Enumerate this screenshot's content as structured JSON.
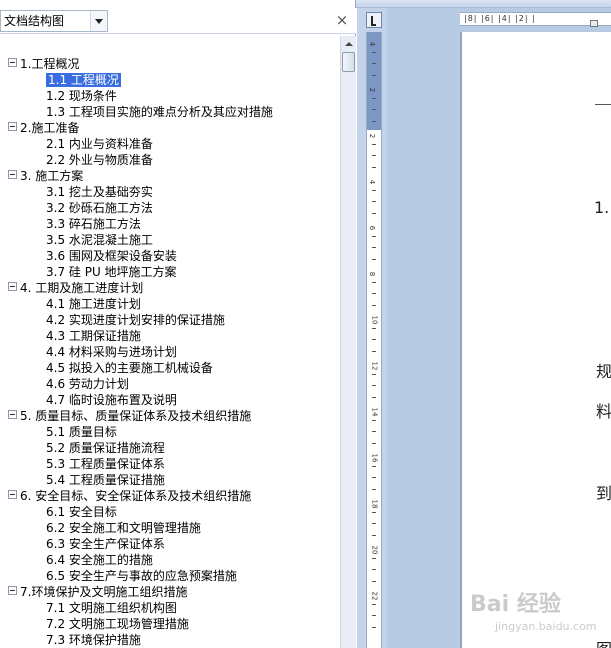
{
  "pane": {
    "view_label": "文档结构图",
    "close_glyph": "×"
  },
  "tree": [
    {
      "level": 1,
      "label": "1.工程概况",
      "expanded": true
    },
    {
      "level": 2,
      "label": "1.1 工程概况",
      "selected": true
    },
    {
      "level": 2,
      "label": "1.2 现场条件"
    },
    {
      "level": 2,
      "label": "1.3 工程项目实施的难点分析及其应对措施"
    },
    {
      "level": 1,
      "label": "2.施工准备",
      "expanded": true
    },
    {
      "level": 2,
      "label": "2.1 内业与资料准备"
    },
    {
      "level": 2,
      "label": "2.2 外业与物质准备"
    },
    {
      "level": 1,
      "label": "3. 施工方案",
      "expanded": true
    },
    {
      "level": 2,
      "label": "3.1 挖土及基础夯实"
    },
    {
      "level": 2,
      "label": "3.2 砂砾石施工方法"
    },
    {
      "level": 2,
      "label": "3.3 碎石施工方法"
    },
    {
      "level": 2,
      "label": "3.5 水泥混凝土施工"
    },
    {
      "level": 2,
      "label": "3.6 围网及框架设备安装"
    },
    {
      "level": 2,
      "label": "3.7 硅 PU 地坪施工方案"
    },
    {
      "level": 1,
      "label": "4. 工期及施工进度计划",
      "expanded": true
    },
    {
      "level": 2,
      "label": "4.1 施工进度计划"
    },
    {
      "level": 2,
      "label": "4.2 实现进度计划安排的保证措施"
    },
    {
      "level": 2,
      "label": "4.3 工期保证措施"
    },
    {
      "level": 2,
      "label": "4.4 材料采购与进场计划"
    },
    {
      "level": 2,
      "label": "4.5 拟投入的主要施工机械设备"
    },
    {
      "level": 2,
      "label": "4.6 劳动力计划"
    },
    {
      "level": 2,
      "label": "4.7 临时设施布置及说明"
    },
    {
      "level": 1,
      "label": "5. 质量目标、质量保证体系及技术组织措施",
      "expanded": true
    },
    {
      "level": 2,
      "label": "5.1 质量目标"
    },
    {
      "level": 2,
      "label": "5.2 质量保证措施流程"
    },
    {
      "level": 2,
      "label": "5.3 工程质量保证体系"
    },
    {
      "level": 2,
      "label": "5.4 工程质量保证措施"
    },
    {
      "level": 1,
      "label": "6. 安全目标、安全保证体系及技术组织措施",
      "expanded": true
    },
    {
      "level": 2,
      "label": "6.1 安全目标"
    },
    {
      "level": 2,
      "label": "6.2 安全施工和文明管理措施"
    },
    {
      "level": 2,
      "label": "6.3 安全生产保证体系"
    },
    {
      "level": 2,
      "label": "6.4 安全施工的措施"
    },
    {
      "level": 2,
      "label": "6.5 安全生产与事故的应急预案措施"
    },
    {
      "level": 1,
      "label": "7.环境保护及文明施工组织措施",
      "expanded": true
    },
    {
      "level": 2,
      "label": "7.1 文明施工组织机构图"
    },
    {
      "level": 2,
      "label": "7.2 文明施工现场管理措施"
    },
    {
      "level": 2,
      "label": "7.3 环境保护措施"
    }
  ],
  "ruler": {
    "horizontal_text": "|8| |6| |4| |2| |",
    "vertical_numbers": [
      "4",
      "2",
      "2",
      "4",
      "6",
      "8",
      "10",
      "12",
      "14",
      "16",
      "18",
      "20",
      "22"
    ]
  },
  "document": {
    "fragments": [
      "1.",
      "规",
      "料",
      "到",
      "图"
    ]
  },
  "watermark": {
    "brand": "Bai 经验",
    "sub": "jingyan.baidu.com"
  },
  "colors": {
    "selection": "#3a6ee0",
    "ruler_band": "#c3d3e9",
    "doc_background": "#b8cbe4"
  }
}
